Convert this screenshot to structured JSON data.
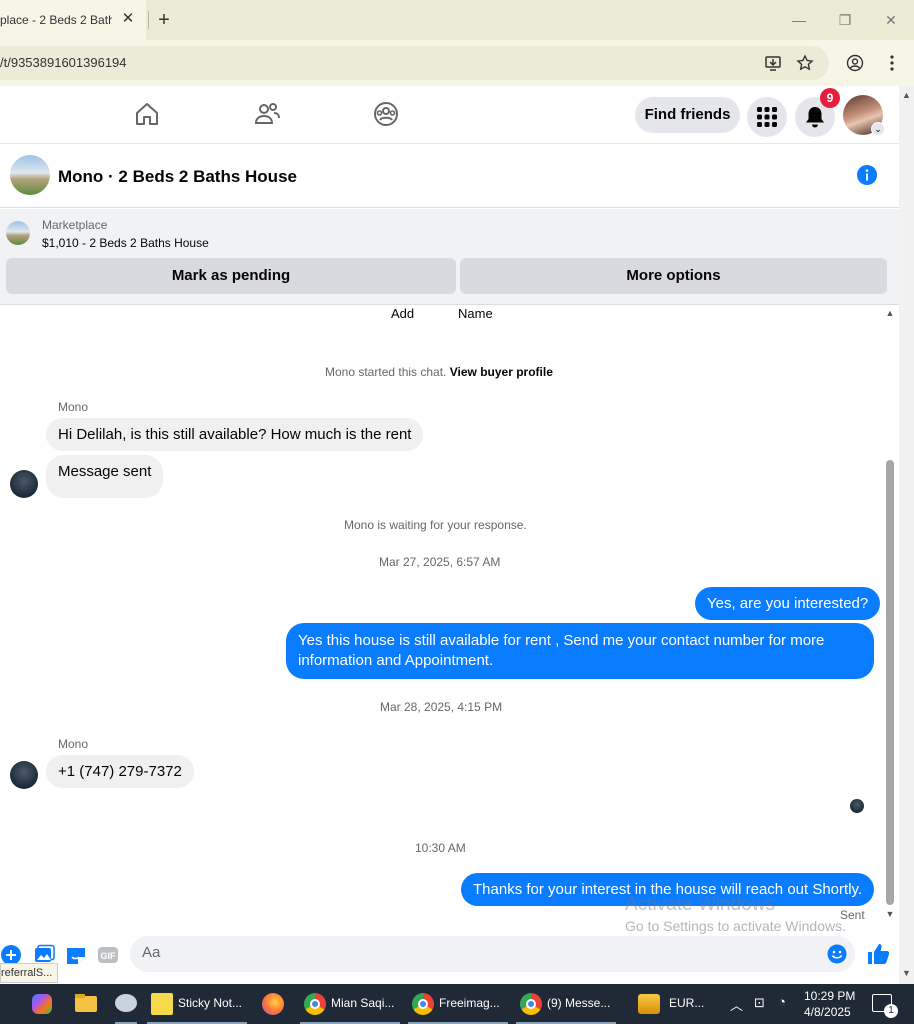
{
  "browser": {
    "tab_title": "place - 2 Beds 2 Bath",
    "tab_close": "✕",
    "new_tab": "+",
    "url": "/t/9353891601396194"
  },
  "fb_nav": {
    "find_friends": "Find friends",
    "notification_count": "9"
  },
  "chat": {
    "title": "Mono · 2 Beds 2 Baths House"
  },
  "marketplace": {
    "label": "Marketplace",
    "listing": "$1,010 - 2 Beds 2 Baths House",
    "mark_pending": "Mark as pending",
    "more_options": "More options"
  },
  "messages": {
    "top_add": "Add",
    "top_name": "Name",
    "started_text": "Mono started this chat.",
    "view_buyer_profile": "View buyer profile",
    "sender_1": "Mono",
    "msg_in_1": "Hi Delilah, is this still available?  How much is the rent",
    "msg_in_2": "Message sent",
    "waiting": "Mono is waiting for your response.",
    "ts_1": "Mar 27, 2025, 6:57 AM",
    "msg_out_1": "Yes, are you interested?",
    "msg_out_2": "Yes this house is still available for rent , Send me your contact number for more information and Appointment.",
    "ts_2": "Mar 28, 2025, 4:15 PM",
    "sender_2": "Mono",
    "msg_in_3": "+1 (747) 279-7372",
    "ts_3": "10:30 AM",
    "msg_out_3": "Thanks for your interest in the house will reach out Shortly.",
    "sent_label": "Sent"
  },
  "watermark": {
    "line1": "Activate Windows",
    "line2": "Go to Settings to activate Windows."
  },
  "composer": {
    "placeholder": "Aa",
    "status_tip": "referralS..."
  },
  "taskbar": {
    "items": [
      "Sticky Not...",
      "Mian Saqi...",
      "Freeimag...",
      "(9) Messe...",
      "EUR..."
    ],
    "time": "10:29 PM",
    "date": "4/8/2025",
    "notif_count": "1"
  },
  "colors": {
    "accent": "#0a7cff",
    "badge": "#e41e3f"
  }
}
